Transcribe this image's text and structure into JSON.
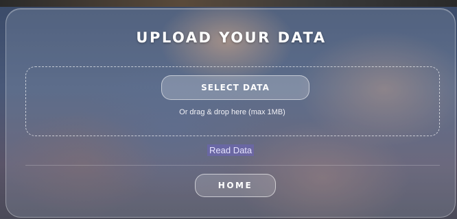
{
  "panel": {
    "title": "UPLOAD YOUR DATA"
  },
  "dropzone": {
    "select_button_label": "SELECT DATA",
    "hint": "Or drag & drop here (max 1MB)"
  },
  "read_link_label": "Read Data",
  "home_button_label": "HOME"
}
